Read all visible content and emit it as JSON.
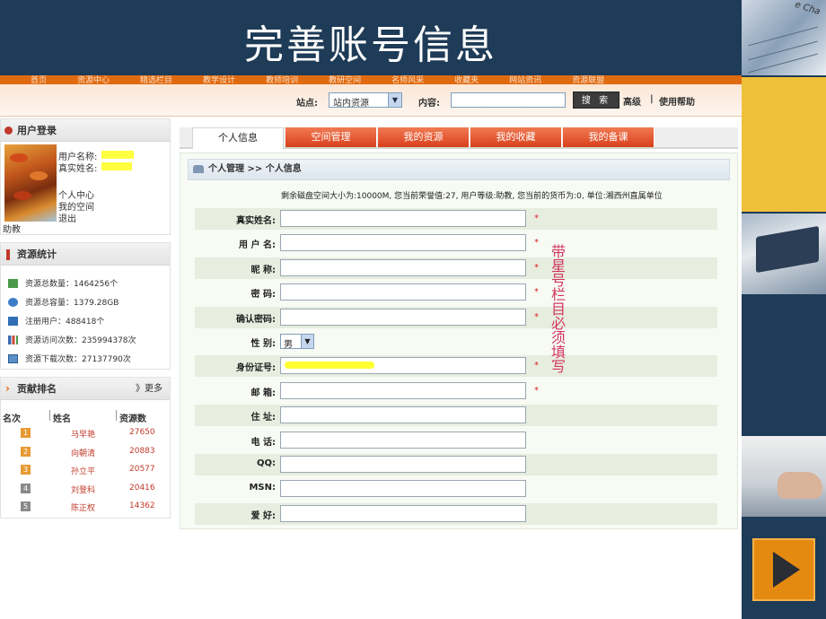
{
  "slide_title": "完善账号信息",
  "colors": {
    "banner": "#1e3b57",
    "accent": "#e06a10",
    "tab_red": "#d9401c",
    "required": "#dd2222",
    "annotation": "#d2355c"
  },
  "nav_items": [
    "首页",
    "资源中心",
    "精选栏目",
    "教学设计",
    "教师培训",
    "教研空间",
    "名师风采",
    "收藏夹",
    "网站资讯",
    "资源联盟"
  ],
  "search": {
    "site_label": "站点:",
    "site_value": "站内资源",
    "content_label": "内容:",
    "content_value": "",
    "search_button": "搜 索",
    "advanced_link": "高级",
    "divider": "|",
    "help_link": "使用帮助"
  },
  "login_panel": {
    "title": "用户登录",
    "username_label": "用户名称:",
    "realname_label": "真实姓名:",
    "links": [
      "个人中心",
      "我的空间",
      "退出"
    ],
    "rank_text": "助教"
  },
  "stats_panel": {
    "title": "资源统计",
    "items": [
      {
        "text": "资源总数量：1464256个",
        "icon": "chart-icon"
      },
      {
        "text": "资源总容量：1379.28GB",
        "icon": "disk-icon"
      },
      {
        "text": "注册用户：488418个",
        "icon": "user-icon"
      },
      {
        "text": "资源访问次数：235994378次",
        "icon": "bar-chart-icon"
      },
      {
        "text": "资源下载次数：27137790次",
        "icon": "download-icon"
      }
    ]
  },
  "rank_panel": {
    "title": "贡献排名",
    "more": "》更多",
    "headers": [
      "名次",
      "姓名",
      "资源数"
    ],
    "rows": [
      {
        "rank": "1",
        "name": "马早艳",
        "count": "27650"
      },
      {
        "rank": "2",
        "name": "向朝清",
        "count": "20883"
      },
      {
        "rank": "3",
        "name": "孙立平",
        "count": "20577"
      },
      {
        "rank": "4",
        "name": "刘登科",
        "count": "20416"
      },
      {
        "rank": "5",
        "name": "陈正权",
        "count": "14362"
      }
    ]
  },
  "tabs": [
    "个人信息",
    "空间管理",
    "我的资源",
    "我的收藏",
    "我的备课"
  ],
  "breadcrumb": "个人管理 >> 个人信息",
  "quota_text": "剩余磁盘空间大小为:10000M, 您当前荣誉值:27, 用户等级:助教, 您当前的货币为:0, 单位:湘西州直属单位",
  "form": {
    "fields": [
      {
        "label": "真实姓名:",
        "value": "",
        "required": true
      },
      {
        "label": "用 户 名:",
        "value": "",
        "required": true
      },
      {
        "label": "昵      称:",
        "value": "",
        "required": true
      },
      {
        "label": "密      码:",
        "value": "",
        "required": true
      },
      {
        "label": "确认密码:",
        "value": "",
        "required": true
      },
      {
        "label": "性      别:",
        "value": "男",
        "type": "select",
        "required": false
      },
      {
        "label": "身份证号:",
        "value": "",
        "required": true
      },
      {
        "label": "邮      箱:",
        "value": "",
        "required": true
      },
      {
        "label": "住      址:",
        "value": "",
        "required": false
      },
      {
        "label": "电      话:",
        "value": "",
        "required": false
      },
      {
        "label": "QQ:",
        "value": "",
        "required": false
      },
      {
        "label": "MSN:",
        "value": "",
        "required": false
      },
      {
        "label": "爱      好:",
        "value": "",
        "required": false
      }
    ],
    "required_mark": "*"
  },
  "annotation": "带星号栏目必须填写",
  "decor_tile_text": "e Cha"
}
